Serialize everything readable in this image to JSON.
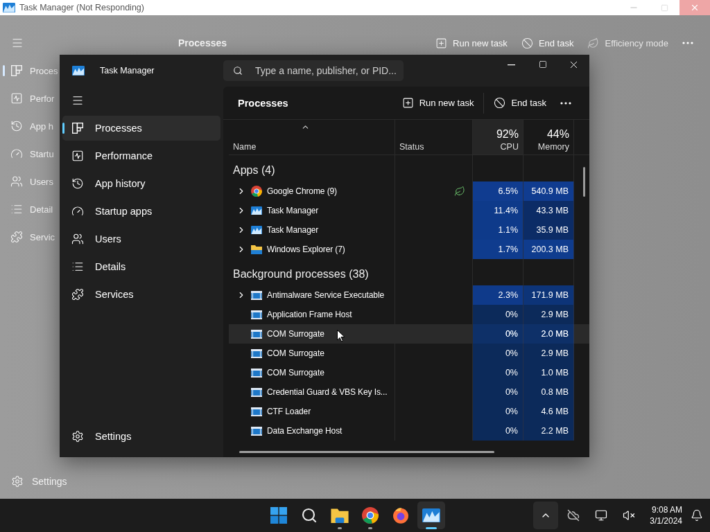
{
  "background_window": {
    "title": "Task Manager (Not Responding)",
    "page_title": "Processes",
    "nav": [
      {
        "label": "Proces",
        "kind": "processes",
        "selected": true
      },
      {
        "label": "Perfor",
        "kind": "performance",
        "selected": false
      },
      {
        "label": "App h",
        "kind": "history",
        "selected": false
      },
      {
        "label": "Startu",
        "kind": "startup",
        "selected": false
      },
      {
        "label": "Users",
        "kind": "users",
        "selected": false
      },
      {
        "label": "Detail",
        "kind": "details",
        "selected": false
      },
      {
        "label": "Servic",
        "kind": "services",
        "selected": false
      }
    ],
    "settings": "Settings",
    "toolbar": [
      {
        "label": "Run new task",
        "kind": "run",
        "disabled": false
      },
      {
        "label": "End task",
        "kind": "end",
        "disabled": false
      },
      {
        "label": "Efficiency mode",
        "kind": "efficiency",
        "disabled": true
      }
    ]
  },
  "window": {
    "title": "Task Manager",
    "search": {
      "placeholder": "Type a name, publisher, or PID..."
    },
    "nav": [
      {
        "label": "Processes",
        "kind": "processes",
        "selected": true
      },
      {
        "label": "Performance",
        "kind": "performance",
        "selected": false
      },
      {
        "label": "App history",
        "kind": "history",
        "selected": false
      },
      {
        "label": "Startup apps",
        "kind": "startup",
        "selected": false
      },
      {
        "label": "Users",
        "kind": "users",
        "selected": false
      },
      {
        "label": "Details",
        "kind": "details",
        "selected": false
      },
      {
        "label": "Services",
        "kind": "services",
        "selected": false
      }
    ],
    "settings": "Settings",
    "page_title": "Processes",
    "toolbar": [
      {
        "label": "Run new task",
        "kind": "run"
      },
      {
        "label": "End task",
        "kind": "end"
      }
    ],
    "table": {
      "columns": [
        {
          "label": "Name"
        },
        {
          "label": "Status"
        },
        {
          "label": "CPU",
          "total": "92%"
        },
        {
          "label": "Memory",
          "total": "44%"
        }
      ],
      "groups": [
        {
          "title": "Apps (4)",
          "rows": [
            {
              "name": "Google Chrome (9)",
              "kind": "chrome",
              "expandable": true,
              "efficiency": true,
              "hovered": false,
              "cpu": {
                "text": "6.5%",
                "color": "#103c90"
              },
              "memory": {
                "text": "540.9 MB",
                "color": "#103c90"
              }
            },
            {
              "name": "Task Manager",
              "kind": "taskmgr",
              "expandable": true,
              "efficiency": false,
              "hovered": false,
              "cpu": {
                "text": "11.4%",
                "color": "#0e3a8a"
              },
              "memory": {
                "text": "43.3 MB",
                "color": "#0c2c66"
              }
            },
            {
              "name": "Task Manager",
              "kind": "taskmgr",
              "expandable": true,
              "efficiency": false,
              "hovered": false,
              "cpu": {
                "text": "1.1%",
                "color": "#0e3a8a"
              },
              "memory": {
                "text": "35.9 MB",
                "color": "#0c2c66"
              }
            },
            {
              "name": "Windows Explorer (7)",
              "kind": "explorer",
              "expandable": true,
              "efficiency": false,
              "hovered": false,
              "cpu": {
                "text": "1.7%",
                "color": "#0f3c8e"
              },
              "memory": {
                "text": "200.3 MB",
                "color": "#0f3c8e"
              }
            }
          ]
        },
        {
          "title": "Background processes (38)",
          "rows": [
            {
              "name": "Antimalware Service Executable",
              "kind": "service",
              "expandable": true,
              "efficiency": false,
              "hovered": false,
              "cpu": {
                "text": "2.3%",
                "color": "#0f3a8a"
              },
              "memory": {
                "text": "171.9 MB",
                "color": "#0d3478"
              }
            },
            {
              "name": "Application Frame Host",
              "kind": "service",
              "expandable": false,
              "efficiency": false,
              "hovered": false,
              "cpu": {
                "text": "0%",
                "color": "#0c2a5a"
              },
              "memory": {
                "text": "2.9 MB",
                "color": "#0c2a5a"
              }
            },
            {
              "name": "COM Surrogate",
              "kind": "service",
              "expandable": false,
              "efficiency": false,
              "hovered": true,
              "cpu": {
                "text": "0%",
                "color": "#0c2a5a"
              },
              "memory": {
                "text": "2.0 MB",
                "color": "#0c2a5a"
              }
            },
            {
              "name": "COM Surrogate",
              "kind": "service",
              "expandable": false,
              "efficiency": false,
              "hovered": false,
              "cpu": {
                "text": "0%",
                "color": "#0c2a5a"
              },
              "memory": {
                "text": "2.9 MB",
                "color": "#0c2a5a"
              }
            },
            {
              "name": "COM Surrogate",
              "kind": "service",
              "expandable": false,
              "efficiency": false,
              "hovered": false,
              "cpu": {
                "text": "0%",
                "color": "#0c2a5a"
              },
              "memory": {
                "text": "1.0 MB",
                "color": "#0c2a5a"
              }
            },
            {
              "name": "Credential Guard & VBS Key Is...",
              "kind": "service",
              "expandable": false,
              "efficiency": false,
              "hovered": false,
              "cpu": {
                "text": "0%",
                "color": "#0c2a5a"
              },
              "memory": {
                "text": "0.8 MB",
                "color": "#0c2a5a"
              }
            },
            {
              "name": "CTF Loader",
              "kind": "service",
              "expandable": false,
              "efficiency": false,
              "hovered": false,
              "cpu": {
                "text": "0%",
                "color": "#0c2a5a"
              },
              "memory": {
                "text": "4.6 MB",
                "color": "#0c2a5a"
              }
            },
            {
              "name": "Data Exchange Host",
              "kind": "service",
              "expandable": false,
              "efficiency": false,
              "hovered": false,
              "cpu": {
                "text": "0%",
                "color": "#0c2a5a"
              },
              "memory": {
                "text": "2.2 MB",
                "color": "#0c2a5a"
              }
            }
          ]
        }
      ]
    }
  },
  "taskbar": {
    "apps": [
      {
        "kind": "start",
        "running": false,
        "active": false
      },
      {
        "kind": "search",
        "running": false,
        "active": false
      },
      {
        "kind": "explorer",
        "running": true,
        "active": false
      },
      {
        "kind": "chrome",
        "running": true,
        "active": false
      },
      {
        "kind": "firefox",
        "running": false,
        "active": false
      },
      {
        "kind": "taskmgr",
        "running": true,
        "active": true
      }
    ],
    "tray": [
      {
        "kind": "chevron"
      },
      {
        "kind": "cloud"
      },
      {
        "kind": "network"
      },
      {
        "kind": "volume"
      }
    ],
    "time": "9:08 AM",
    "date": "3/1/2024"
  }
}
